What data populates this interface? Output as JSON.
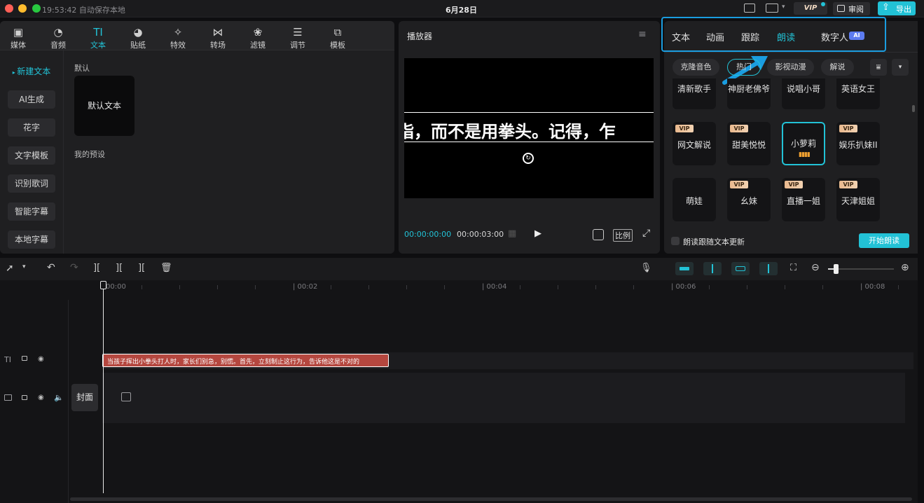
{
  "titlebar": {
    "autosave": "19:53:42 自动保存本地",
    "project_title": "6月28日",
    "vip": "VIP",
    "review": "审阅",
    "export": "导出"
  },
  "toolbar": {
    "categories": [
      {
        "label": "媒体",
        "icon": "media-icon"
      },
      {
        "label": "音频",
        "icon": "audio-icon"
      },
      {
        "label": "文本",
        "icon": "text-icon"
      },
      {
        "label": "贴纸",
        "icon": "sticker-icon"
      },
      {
        "label": "特效",
        "icon": "effects-icon"
      },
      {
        "label": "转场",
        "icon": "transition-icon"
      },
      {
        "label": "滤镜",
        "icon": "filter-icon"
      },
      {
        "label": "调节",
        "icon": "adjust-icon"
      },
      {
        "label": "模板",
        "icon": "template-icon"
      }
    ],
    "active": "文本"
  },
  "text_sidebar": {
    "items": [
      "新建文本",
      "AI生成",
      "花字",
      "文字模板",
      "识别歌词",
      "智能字幕",
      "本地字幕"
    ]
  },
  "text_content": {
    "default_section": "默认",
    "default_card": "默认文本",
    "preset_section": "我的预设"
  },
  "player": {
    "title": "播放器",
    "subtitle": "指，而不是用拳头。记得，乍",
    "current_time": "00:00:00:00",
    "total_time": "00:00:03:00",
    "ratio": "比例"
  },
  "inspector": {
    "tabs": [
      "文本",
      "动画",
      "跟踪",
      "朗读",
      "数字人"
    ],
    "active_tab": "朗读",
    "ai_badge": "AI",
    "filter_chips": [
      "克隆音色",
      "热门",
      "影视动漫",
      "解说"
    ],
    "active_chip": "热门",
    "voices_row1": [
      "清新歌手",
      "神厨老佛爷",
      "说唱小哥",
      "英语女王"
    ],
    "voices_row2": [
      {
        "name": "网文解说",
        "vip": true
      },
      {
        "name": "甜美悦悦",
        "vip": true
      },
      {
        "name": "小萝莉",
        "vip": false,
        "selected": true
      },
      {
        "name": "娱乐扒妹II",
        "vip": true
      }
    ],
    "voices_row3": [
      {
        "name": "萌娃",
        "vip": false
      },
      {
        "name": "幺妹",
        "vip": true
      },
      {
        "name": "直播一姐",
        "vip": true
      },
      {
        "name": "天津姐姐",
        "vip": true
      }
    ],
    "vip_label": "VIP",
    "follow_text_update": "朗读跟随文本更新",
    "start_button": "开始朗读"
  },
  "timeline": {
    "ruler": [
      "00:00",
      "| 00:02",
      "| 00:04",
      "| 00:06",
      "| 00:08"
    ],
    "text_clip": "当孩子挥出小拳头打人时，家长们别急，别慌。首先，立刻制止这行为，告诉他这是不对的",
    "cover_label": "封面"
  },
  "colors": {
    "accent": "#22c2d6",
    "highlight_box": "#1a9de0",
    "clip_red": "#b5473f",
    "vip_gold": "#e9b98e"
  }
}
